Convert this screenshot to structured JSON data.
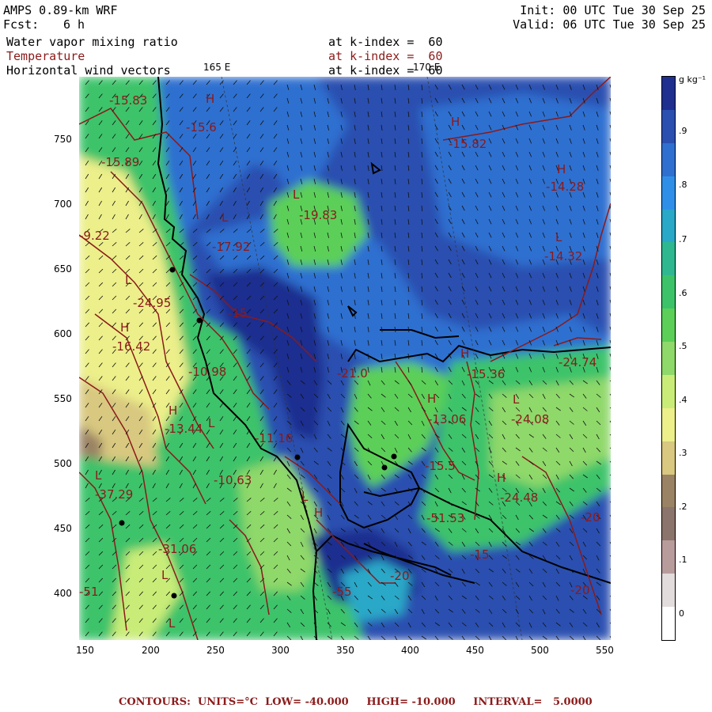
{
  "header": {
    "model": "AMPS 0.89-km WRF",
    "fcst_label": "Fcst:",
    "fcst_value": "6 h",
    "init": "Init: 00 UTC Tue 30 Sep 25",
    "valid": "Valid: 06 UTC Tue 30 Sep 25",
    "field1": "Water vapor mixing ratio",
    "field2": "Temperature",
    "field3": "Horizontal wind vectors",
    "level1": "at k-index =  60",
    "level2": "at k-index =  60",
    "level3": "at k-index =  60",
    "lon_label_1": "165 E",
    "lon_label_2": "170 E"
  },
  "axes": {
    "x_ticks": [
      "150",
      "200",
      "250",
      "300",
      "350",
      "400",
      "450",
      "500",
      "550"
    ],
    "y_ticks": [
      "750",
      "700",
      "650",
      "600",
      "550",
      "500",
      "450",
      "400"
    ]
  },
  "colorbar": {
    "units": "g kg⁻¹",
    "labels": [
      ".9",
      ".8",
      ".7",
      ".6",
      ".5",
      ".4",
      ".3",
      ".2",
      ".1",
      "0"
    ],
    "colors": [
      "#1f2f8f",
      "#2a4fb0",
      "#2f6fd0",
      "#2f8fe8",
      "#2aa8c8",
      "#2fb890",
      "#3cc36a",
      "#5ccf58",
      "#8fd86a",
      "#c9ec78",
      "#ecef8a",
      "#d8c880",
      "#9a8264",
      "#8a746c",
      "#b89c9c",
      "#e2dcdc",
      "#ffffff"
    ]
  },
  "contour_labels": [
    "-15.83",
    "-15.6",
    "-15.89",
    "-9.22",
    "-24.95",
    "-16.42",
    "-10.98",
    "-13.44",
    "-10.63",
    "-37.29",
    "-31.06",
    "-51",
    "-19.83",
    "-17.92",
    "-15",
    "-11.16",
    "-15.82",
    "-14.28",
    "-14.32",
    "-21.0",
    "-15.36",
    "-24.74",
    "-24.08",
    "-13.06",
    "-15.5",
    "-24.48",
    "-20",
    "-51.53",
    "-15",
    "-20",
    "-55",
    "-20"
  ],
  "pressure_marks": [
    "H",
    "L",
    "L",
    "L",
    "H",
    "H",
    "H",
    "L",
    "H",
    "L",
    "L",
    "H",
    "H",
    "L",
    "L",
    "H",
    "L",
    "H",
    "L"
  ],
  "footer": "CONTOURS:  UNITS=°C  LOW= -40.000     HIGH= -10.000     INTERVAL=   5.0000"
}
